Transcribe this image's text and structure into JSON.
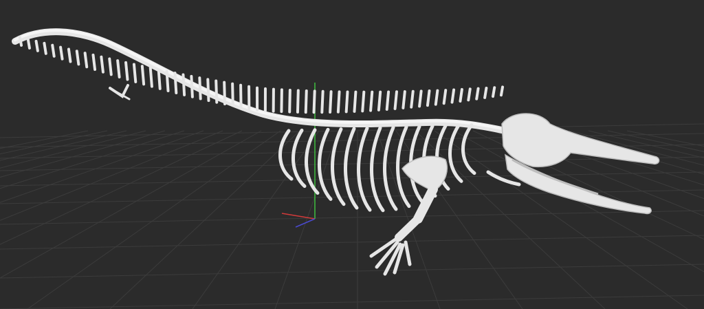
{
  "viewport": {
    "background_color": "#2b2b2b",
    "grid": {
      "visible": true,
      "line_color": "#3c3c3c"
    },
    "gizmo": {
      "x_axis_color": "#d23a3a",
      "y_axis_color": "#3fbf3f",
      "z_axis_color": "#4a4ad0"
    },
    "model": {
      "subject": "whale skeleton",
      "bone_color": "#e6e6e6",
      "bone_shade_color": "#bdbdbd"
    }
  }
}
